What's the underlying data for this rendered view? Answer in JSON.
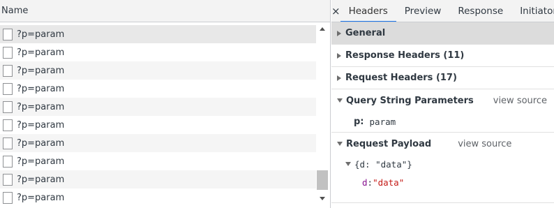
{
  "request_list": {
    "column_name": "Name",
    "rows": [
      {
        "label": "?p=param",
        "selected": true
      },
      {
        "label": "?p=param"
      },
      {
        "label": "?p=param"
      },
      {
        "label": "?p=param"
      },
      {
        "label": "?p=param"
      },
      {
        "label": "?p=param"
      },
      {
        "label": "?p=param"
      },
      {
        "label": "?p=param"
      },
      {
        "label": "?p=param"
      },
      {
        "label": "?p=param"
      }
    ]
  },
  "details": {
    "close_icon": "×",
    "tabs": [
      {
        "label": "Headers",
        "active": true
      },
      {
        "label": "Preview"
      },
      {
        "label": "Response"
      },
      {
        "label": "Initiator"
      }
    ],
    "sections": {
      "general": {
        "title": "General",
        "expanded": false
      },
      "response_headers": {
        "title": "Response Headers (11)",
        "expanded": false
      },
      "request_headers": {
        "title": "Request Headers (17)",
        "expanded": false
      },
      "query_string": {
        "title": "Query String Parameters",
        "expanded": true,
        "view_source": "view source",
        "params": [
          {
            "key": "p:",
            "value": "param"
          }
        ]
      },
      "request_payload": {
        "title": "Request Payload",
        "expanded": true,
        "view_source": "view source",
        "root_text": "{d: \"data\"}",
        "children": [
          {
            "key": "d",
            "sep": ": ",
            "value": "\"data\""
          }
        ]
      }
    }
  },
  "colors": {
    "active_tab_underline": "#1a73e8",
    "json_key": "#881391",
    "json_string": "#c41a16"
  }
}
